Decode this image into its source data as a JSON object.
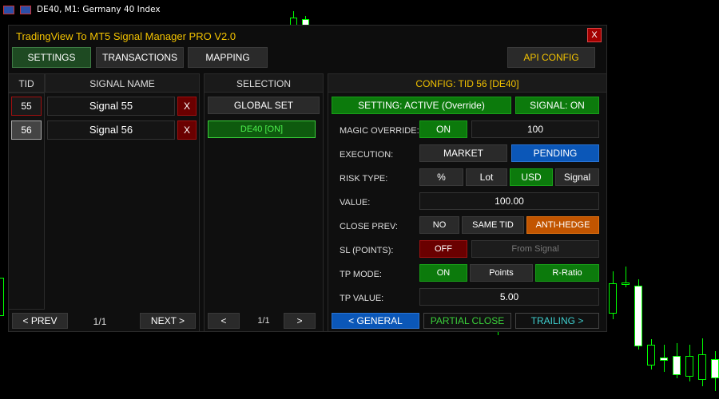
{
  "chart": {
    "title": "DE40, M1:  Germany 40 Index"
  },
  "window": {
    "title": "TradingView To MT5 Signal Manager PRO V2.0",
    "close_label": "X"
  },
  "tabs": [
    {
      "label": "SETTINGS"
    },
    {
      "label": "TRANSACTIONS"
    },
    {
      "label": "MAPPING"
    }
  ],
  "api_config_label": "API CONFIG",
  "signals": {
    "header_tid": "TID",
    "header_name": "SIGNAL NAME",
    "rows": [
      {
        "tid": "55",
        "name": "Signal 55",
        "delete": "X"
      },
      {
        "tid": "56",
        "name": "Signal 56",
        "delete": "X"
      }
    ],
    "prev_label": "< PREV",
    "page": "1/1",
    "next_label": "NEXT >"
  },
  "selection": {
    "header": "SELECTION",
    "global_set": "GLOBAL SET",
    "item": "DE40 [ON]",
    "prev": "<",
    "page": "1/1",
    "next": ">"
  },
  "config": {
    "header": "CONFIG: TID 56 [DE40]",
    "setting_status": "SETTING: ACTIVE (Override)",
    "signal_status": "SIGNAL: ON",
    "magic_override": {
      "label": "MAGIC OVERRIDE:",
      "toggle": "ON",
      "value": "100"
    },
    "execution": {
      "label": "EXECUTION:",
      "options": [
        "MARKET",
        "PENDING"
      ],
      "selected": "PENDING"
    },
    "risk_type": {
      "label": "RISK TYPE:",
      "options": [
        "%",
        "Lot",
        "USD",
        "Signal"
      ],
      "selected": "USD"
    },
    "value": {
      "label": "VALUE:",
      "value": "100.00"
    },
    "close_prev": {
      "label": "CLOSE PREV:",
      "options": [
        "NO",
        "SAME TID",
        "ANTI-HEDGE"
      ],
      "selected": "ANTI-HEDGE"
    },
    "sl": {
      "label": "SL (POINTS):",
      "toggle": "OFF",
      "placeholder": "From Signal"
    },
    "tp_mode": {
      "label": "TP MODE:",
      "options": [
        "ON",
        "Points",
        "R-Ratio"
      ],
      "selected": "ON"
    },
    "tp_value": {
      "label": "TP VALUE:",
      "value": "5.00"
    },
    "nav": {
      "general": "< GENERAL",
      "partial_close": "PARTIAL CLOSE",
      "trailing": "TRAILING >"
    }
  },
  "colors": {
    "title_gold": "#f2c200",
    "active_green": "#0c7a0c",
    "selected_blue": "#0b57b8",
    "selected_orange": "#c25500",
    "off_red": "#6a0000",
    "candle_green": "#00ff00"
  }
}
